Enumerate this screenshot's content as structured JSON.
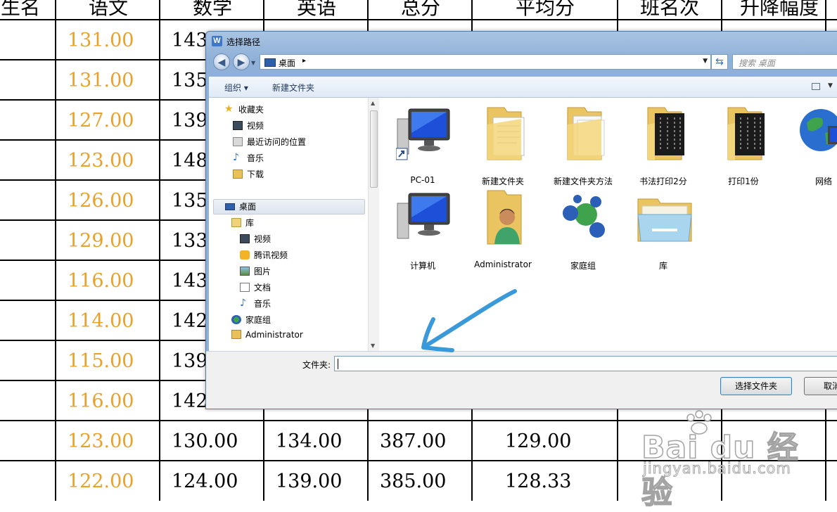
{
  "sheet": {
    "headers": [
      "生名",
      "语文",
      "数学",
      "英语",
      "总分",
      "平均分",
      "班名次",
      "升降幅度"
    ],
    "yuwen": [
      "131.00",
      "131.00",
      "127.00",
      "123.00",
      "126.00",
      "129.00",
      "116.00",
      "114.00",
      "115.00",
      "116.00",
      "123.00",
      "122.00"
    ],
    "shuxue": [
      "143",
      "135",
      "139",
      "148",
      "135",
      "133",
      "143",
      "142",
      "139",
      "142",
      "130.00",
      "124.00"
    ],
    "yingyu_visible": [
      "134.00",
      "139.00"
    ],
    "zongfen_visible": [
      "387.00",
      "385.00"
    ],
    "pingjun_visible": [
      "129.00",
      "128.33"
    ],
    "colors": {
      "yuwen": "#e8a12a"
    }
  },
  "watermark": {
    "main": "Bai du 经验",
    "sub": "jingyan.baidu.com"
  },
  "dialog": {
    "title": "选择路径",
    "address": {
      "location": "桌面",
      "separator": "▸"
    },
    "search_placeholder": "搜索 桌面",
    "toolbar": {
      "organize": "组织 ▾",
      "new_folder": "新建文件夹"
    },
    "nav": {
      "favorites": "收藏夹",
      "video": "视频",
      "recent": "最近访问的位置",
      "music": "音乐",
      "downloads": "下载",
      "desktop": "桌面",
      "library": "库",
      "lib_video": "视频",
      "lib_tencent": "腾讯视频",
      "lib_pictures": "图片",
      "lib_docs": "文档",
      "lib_music": "音乐",
      "homegroup": "家庭组",
      "admin": "Administrator"
    },
    "items": [
      "PC-01",
      "新建文件夹",
      "新建文件夹方法",
      "书法打印2分",
      "打印1份",
      "网络",
      "计算机",
      "Administrator",
      "家庭组",
      "库"
    ],
    "folder_label": "文件夹:",
    "folder_value": "",
    "buttons": {
      "select": "选择文件夹",
      "cancel": "取消"
    }
  }
}
